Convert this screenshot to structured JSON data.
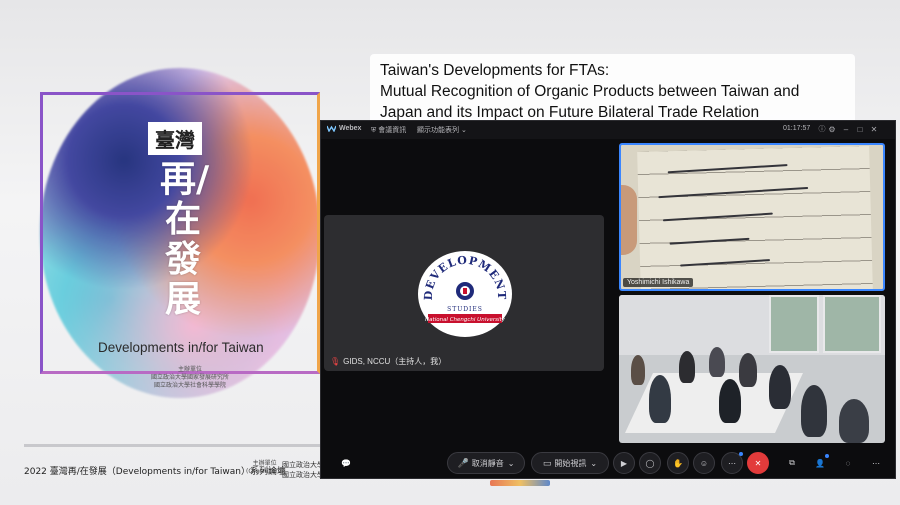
{
  "slide": {
    "badge": "臺灣",
    "vertical_title": "再/在發展",
    "subtitle": "Developments in/for Taiwan",
    "organizer_label": "主辦單位",
    "organizer_line1": "國立政治大學國家發展研究所",
    "organizer_line2": "國立政治大學社會科學學院",
    "footer_series": "2022 臺灣再/在發展（Developments in/for Taiwan）系列論壇",
    "footer_org_label_1": "主辦單位",
    "footer_org_label_2": "(Organizers)",
    "footer_org_1": "國立政治大學國",
    "footer_org_2": "國立政治大學社",
    "talk_title_line1": "Taiwan's Developments for FTAs:",
    "talk_title_line2": "Mutual Recognition of Organic Products between Taiwan and",
    "talk_title_line3": "Japan and its Impact on Future Bilateral Trade Relation"
  },
  "webex": {
    "app_name": "Webex",
    "menu_info": "會議資訊",
    "menu_layout": "顯示功能表列",
    "timer": "01:17:57",
    "main_tile": {
      "label": "GIDS, NCCU（主持人，我）",
      "logo_top": "DEVELOPMENT",
      "logo_bottom": "STUDIES",
      "logo_ribbon": "National Chengchi University"
    },
    "tile_a_label": "Yoshimichi Ishikawa",
    "controls": {
      "mute_label": "取消靜音",
      "video_label": "開始視訊"
    }
  },
  "colors": {
    "accent_blue": "#3a86ff",
    "end_call_red": "#e23b3b",
    "frame_purple": "#8a54c8",
    "frame_orange": "#f0a54a",
    "logo_navy": "#1f2a7a",
    "logo_red": "#c8102e"
  }
}
